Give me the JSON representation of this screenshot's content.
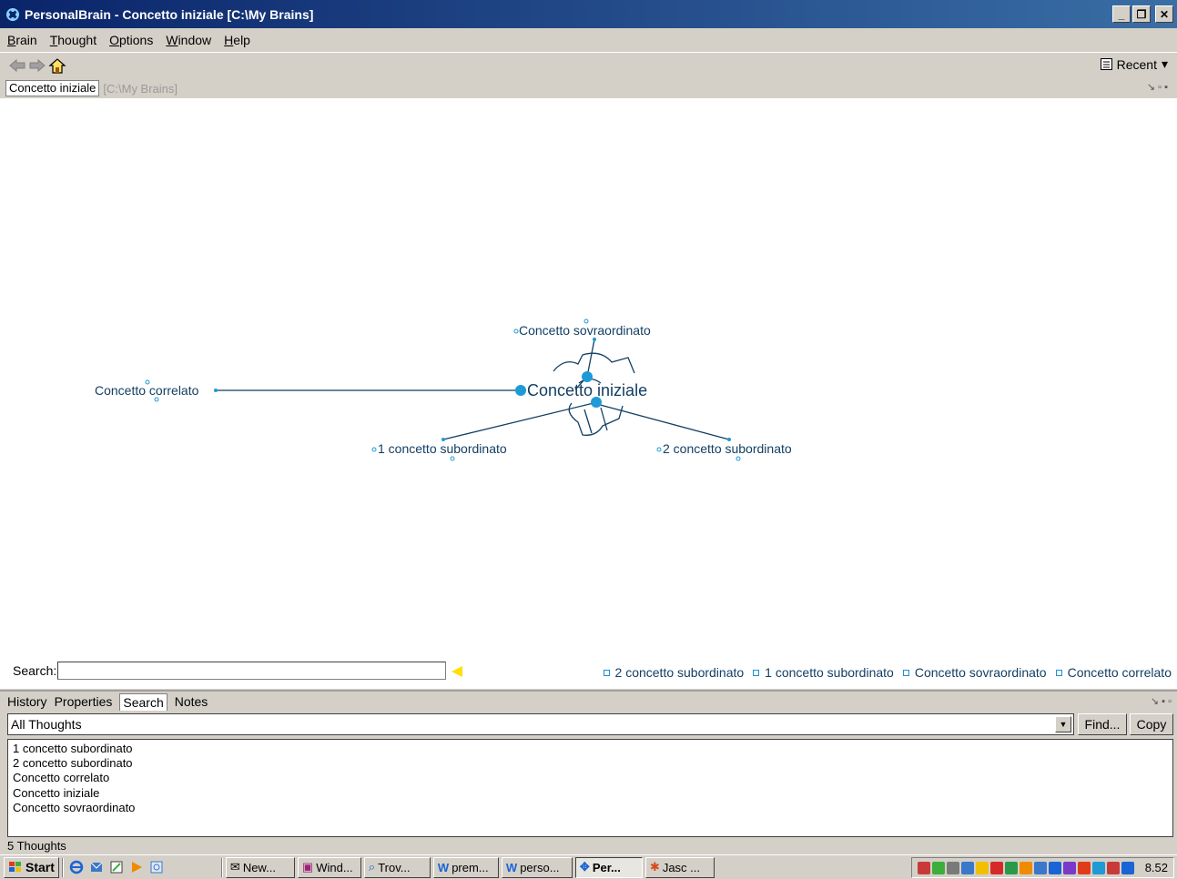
{
  "window": {
    "title": "PersonalBrain - Concetto iniziale [C:\\My Brains]"
  },
  "menu": {
    "items": [
      {
        "label": "Brain",
        "accel": "B",
        "rest": "rain"
      },
      {
        "label": "Thought",
        "accel": "T",
        "rest": "hought"
      },
      {
        "label": "Options",
        "accel": "O",
        "rest": "ptions"
      },
      {
        "label": "Window",
        "accel": "W",
        "rest": "indow"
      },
      {
        "label": "Help",
        "accel": "H",
        "rest": "elp"
      }
    ]
  },
  "toolbar": {
    "recent_label": "Recent"
  },
  "pathbar": {
    "brain_name": "Concetto iniziale",
    "brain_path": "[C:\\My Brains]"
  },
  "plex": {
    "central": "Concetto iniziale",
    "parent": "Concetto sovraordinato",
    "jump": "Concetto correlato",
    "child1": "1 concetto subordinato",
    "child2": "2 concetto subordinato",
    "colors": {
      "line": "#123f63",
      "dot": "#1e9ad6"
    }
  },
  "search": {
    "label": "Search:",
    "value": ""
  },
  "pinned": [
    "2 concetto subordinato",
    "1 concetto subordinato",
    "Concetto sovraordinato",
    "Concetto correlato"
  ],
  "tabs": [
    "History",
    "Properties",
    "Search",
    "Notes"
  ],
  "active_tab": "Search",
  "filter": {
    "selected": "All Thoughts",
    "find_label": "Find...",
    "copy_label": "Copy"
  },
  "results": [
    "1 concetto subordinato",
    "2 concetto subordinato",
    "Concetto correlato",
    "Concetto iniziale",
    "Concetto sovraordinato"
  ],
  "status": "5 Thoughts",
  "taskbar": {
    "start_label": "Start",
    "items": [
      "New...",
      "Wind...",
      "Trov...",
      "prem...",
      "perso...",
      "Per...",
      "Jasc ..."
    ],
    "active_item": "Per...",
    "clock": "8.52"
  }
}
